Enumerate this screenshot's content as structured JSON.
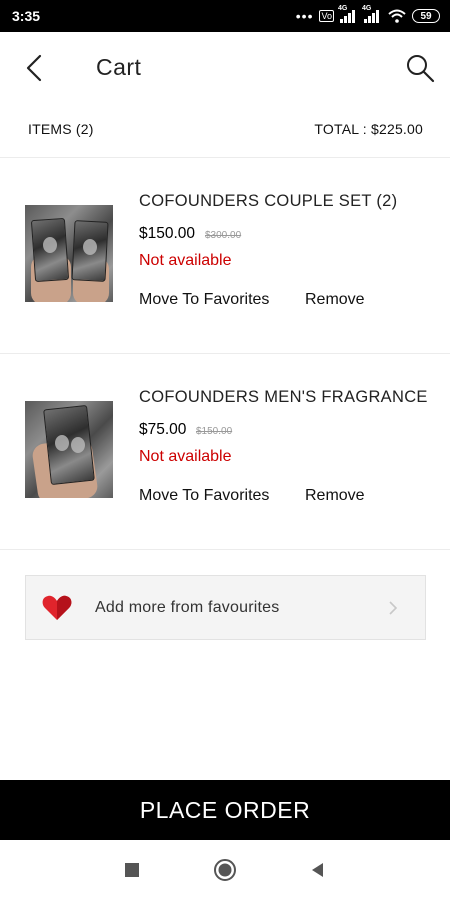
{
  "status_bar": {
    "time": "3:35",
    "dots": "•••",
    "signal1_tag": "4G",
    "volte_label": "Vo",
    "signal2_tag": "4G",
    "battery": "59"
  },
  "header": {
    "title": "Cart",
    "back_icon": "back-arrow-icon",
    "search_icon": "search-icon"
  },
  "summary": {
    "items_label": "ITEMS (2)",
    "total_label": "TOTAL : $225.00"
  },
  "cart": {
    "items": [
      {
        "name": "COFOUNDERS COUPLE SET (2)",
        "price": "$150.00",
        "original_price": "$300.00",
        "availability": "Not available",
        "move_label": "Move To Favorites",
        "remove_label": "Remove"
      },
      {
        "name": "COFOUNDERS MEN'S FRAGRANCE",
        "price": "$75.00",
        "original_price": "$150.00",
        "availability": "Not available",
        "move_label": "Move To Favorites",
        "remove_label": "Remove"
      }
    ]
  },
  "favourites": {
    "label": "Add more from favourites",
    "icon": "heart-icon",
    "chevron": "chevron-right-icon"
  },
  "actions": {
    "place_order_label": "PLACE ORDER"
  },
  "colors": {
    "accent_red": "#cc0000",
    "heart_red": "#e0242c",
    "bar_black": "#000000"
  }
}
